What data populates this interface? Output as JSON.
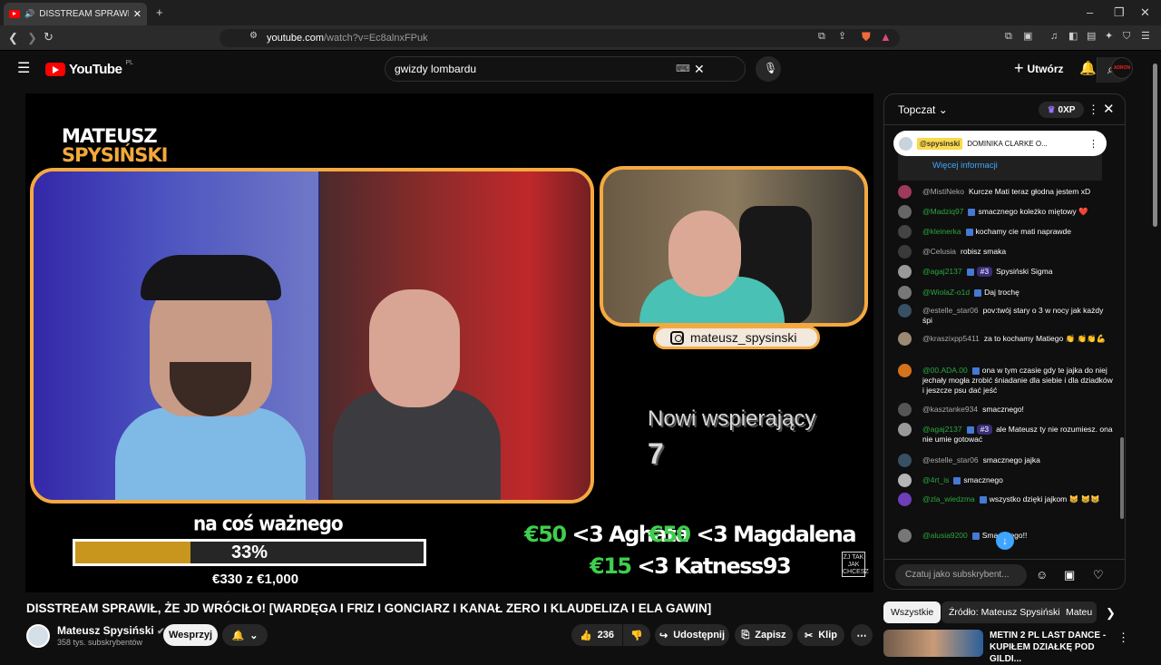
{
  "browser": {
    "tab_title": "DISSTREAM SPRAWIŁ, ŻE JD W",
    "url_host": "youtube.com",
    "url_path": "/watch?v=Ec8alnxFPuk"
  },
  "youtube": {
    "logo_text": "YouTube",
    "country": "PL",
    "search_value": "gwizdy lombardu",
    "create_label": "Utwórz",
    "avatar_text": "ADRON"
  },
  "stream": {
    "brand_line1": "MATEUSZ",
    "brand_line2": "SPYSIŃSKI",
    "instagram": "mateusz_spysinski",
    "new_supporters_label": "Nowi wspierający",
    "new_supporters_count": "7",
    "goal_title": "na coś ważnego",
    "goal_percent": "33%",
    "goal_progress": 0.33,
    "goal_amount": "€330 z €1,000",
    "donations": [
      {
        "amount": "€50",
        "text": "<3 Aghata"
      },
      {
        "amount": "€50",
        "text": "<3 Magdalena"
      },
      {
        "amount": "€15",
        "text": "<3 Katness93"
      }
    ],
    "corner_logo": "ZJ TAK JAK CHCESZ"
  },
  "video": {
    "title": "DISSTREAM SPRAWIŁ, ŻE JD WRÓCIŁO! [WARDĘGA I FRIZ I GONCIARZ I KANAŁ ZERO I KLAUDELIZA I ELA GAWIN]",
    "channel": "Mateusz Spysiński",
    "subscribers": "358 tys. subskrybentów",
    "support_label": "Wesprzyj",
    "likes": "236",
    "share_label": "Udostępnij",
    "save_label": "Zapisz",
    "clip_label": "Klip"
  },
  "chat": {
    "title": "Topczat",
    "xp": "0XP",
    "pinned_user": "@spysinski",
    "pinned_text": "DOMINIKA CLARKE O...",
    "more_info": "Więcej informacji",
    "input_placeholder": "Czatuj jako subskrybent...",
    "messages": [
      {
        "author": "@MistiNeko",
        "text": "Kurcze Mati teraz głodna jestem xD",
        "green": false
      },
      {
        "author": "@Madziq97",
        "text": "smacznego koleżko miętowy ❤️",
        "green": true
      },
      {
        "author": "@kleinerka",
        "text": "kochamy cie mati naprawde",
        "green": true
      },
      {
        "author": "@Celusia",
        "text": "robisz smaka",
        "green": false
      },
      {
        "author": "@agaj2137",
        "text": "Spysiński Sigma",
        "green": true,
        "rank": "#3"
      },
      {
        "author": "@WiolaZ-o1d",
        "text": "Daj trochę",
        "green": true
      },
      {
        "author": "@estelle_star06",
        "text": "pov:twój stary o 3 w nocy jak każdy śpi",
        "green": false
      },
      {
        "author": "@kraszixpp5411",
        "text": "za to kochamy Matiego 👏 👏👏💪",
        "green": false
      },
      {
        "author": "@00.ADA.00",
        "text": "ona w tym czasie gdy te jajka do niej jechały mogła zrobić śniadanie dla siebie i dla dziadków i jeszcze psu dać jeść",
        "green": true
      },
      {
        "author": "@kasztanke934",
        "text": "smacznego!",
        "green": false
      },
      {
        "author": "@agaj2137",
        "text": "ale Mateusz ty nie rozumiesz. ona nie umie gotować",
        "green": true,
        "rank": "#3"
      },
      {
        "author": "@estelle_star06",
        "text": "smacznego jajka",
        "green": false
      },
      {
        "author": "@4rt_is",
        "text": "smacznego",
        "green": true
      },
      {
        "author": "@zla_wiedzma",
        "text": "wszystko dzięki jajkom 😸 😸😸",
        "green": true
      },
      {
        "author": "@alusia9200",
        "text": "Smacznego!!",
        "green": true
      }
    ]
  },
  "chips": {
    "all": "Wszystkie",
    "source": "Źródło: Mateusz Spysiński",
    "more": "Mateu"
  },
  "recommendation": {
    "title": "METIN 2 PL LAST DANCE - KUPIŁEM DZIAŁKĘ POD GILDI..."
  },
  "colors": {
    "accent_orange": "#f4a940",
    "donation_green": "#3fce4d",
    "goal_fill": "#c8961c",
    "youtube_red": "#ff0000",
    "link_blue": "#3ea6ff"
  }
}
